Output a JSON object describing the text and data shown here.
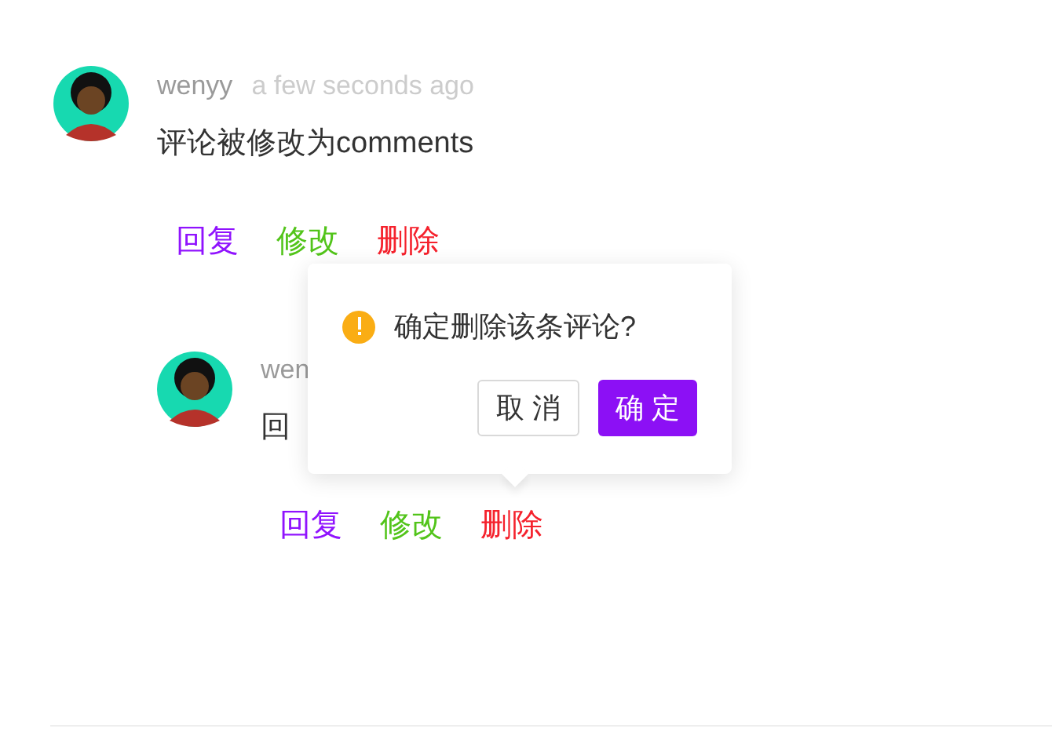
{
  "comment": {
    "author": "wenyy",
    "time": "a few seconds ago",
    "content": "评论被修改为comments",
    "actions": [
      {
        "label": "回复",
        "color": "#9013fe"
      },
      {
        "label": "修改",
        "color": "#52c41a"
      },
      {
        "label": "删除",
        "color": "#f5222d"
      }
    ],
    "reply": {
      "author": "wen",
      "content": "回",
      "actions": [
        {
          "label": "回复",
          "color": "#9013fe"
        },
        {
          "label": "修改",
          "color": "#52c41a"
        },
        {
          "label": "删除",
          "color": "#f5222d"
        }
      ]
    }
  },
  "popconfirm": {
    "message": "确定删除该条评论?",
    "buttons": [
      {
        "label": "取 消",
        "kind": "default"
      },
      {
        "label": "确 定",
        "kind": "primary"
      }
    ]
  }
}
